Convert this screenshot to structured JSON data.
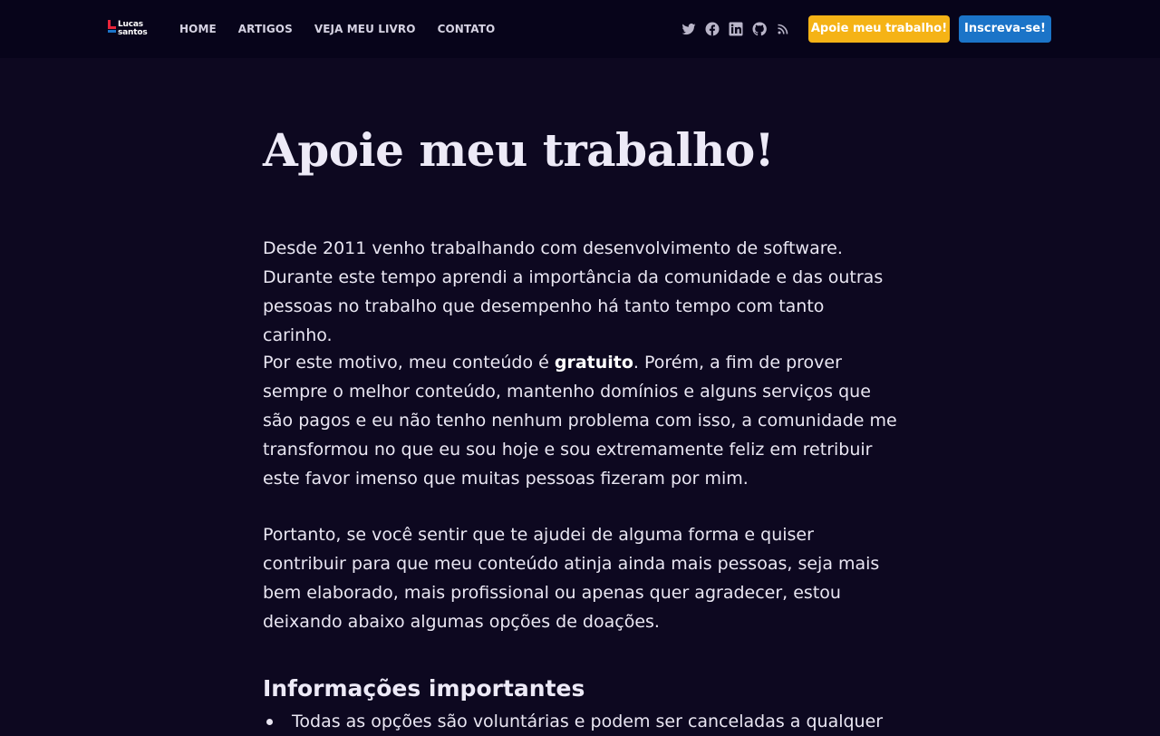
{
  "header": {
    "logo": {
      "line1": "Lucas",
      "line2": "santos"
    },
    "nav": [
      {
        "label": "HOME"
      },
      {
        "label": "ARTIGOS"
      },
      {
        "label": "VEJA MEU LIVRO"
      },
      {
        "label": "CONTATO"
      }
    ],
    "social_icons": [
      "twitter-icon",
      "facebook-icon",
      "linkedin-icon",
      "github-icon",
      "rss-icon"
    ],
    "support_button": "Apoie meu trabalho!",
    "subscribe_button": "Inscreva-se!",
    "top_strip_colors": [
      "#3fb57c",
      "#e8243a",
      "#f5b316",
      "#1b74c8"
    ]
  },
  "main": {
    "title": "Apoie meu trabalho!",
    "paragraph1": "Desde 2011 venho trabalhando com desenvolvimento de software. Durante este tempo aprendi a importância da comunidade e das outras pessoas no trabalho que desempenho há tanto tempo com tanto carinho.",
    "paragraph2_before": "Por este motivo, meu conteúdo é ",
    "paragraph2_bold": "gratuito",
    "paragraph2_after": ". Porém, a fim de prover sempre o melhor conteúdo, mantenho domínios e alguns serviços que são pagos e eu não tenho nenhum problema com isso, a comunidade me transformou no que eu sou hoje e sou extremamente feliz em retribuir este favor imenso que muitas pessoas fizeram por mim.",
    "paragraph3": "Portanto, se você sentir que te ajudei de alguma forma e quiser contribuir para que meu conteúdo atinja ainda mais pessoas, seja mais bem elaborado, mais profissional ou apenas quer agradecer, estou deixando abaixo algumas opções de doações.",
    "subheading": "Informações importantes",
    "info_items": [
      "Todas as opções são voluntárias e podem ser canceladas a qualquer"
    ]
  },
  "colors": {
    "background": "#0d0820",
    "header_bg": "#07041a",
    "support_button": "#f5b316",
    "subscribe_button": "#1b74c8"
  }
}
